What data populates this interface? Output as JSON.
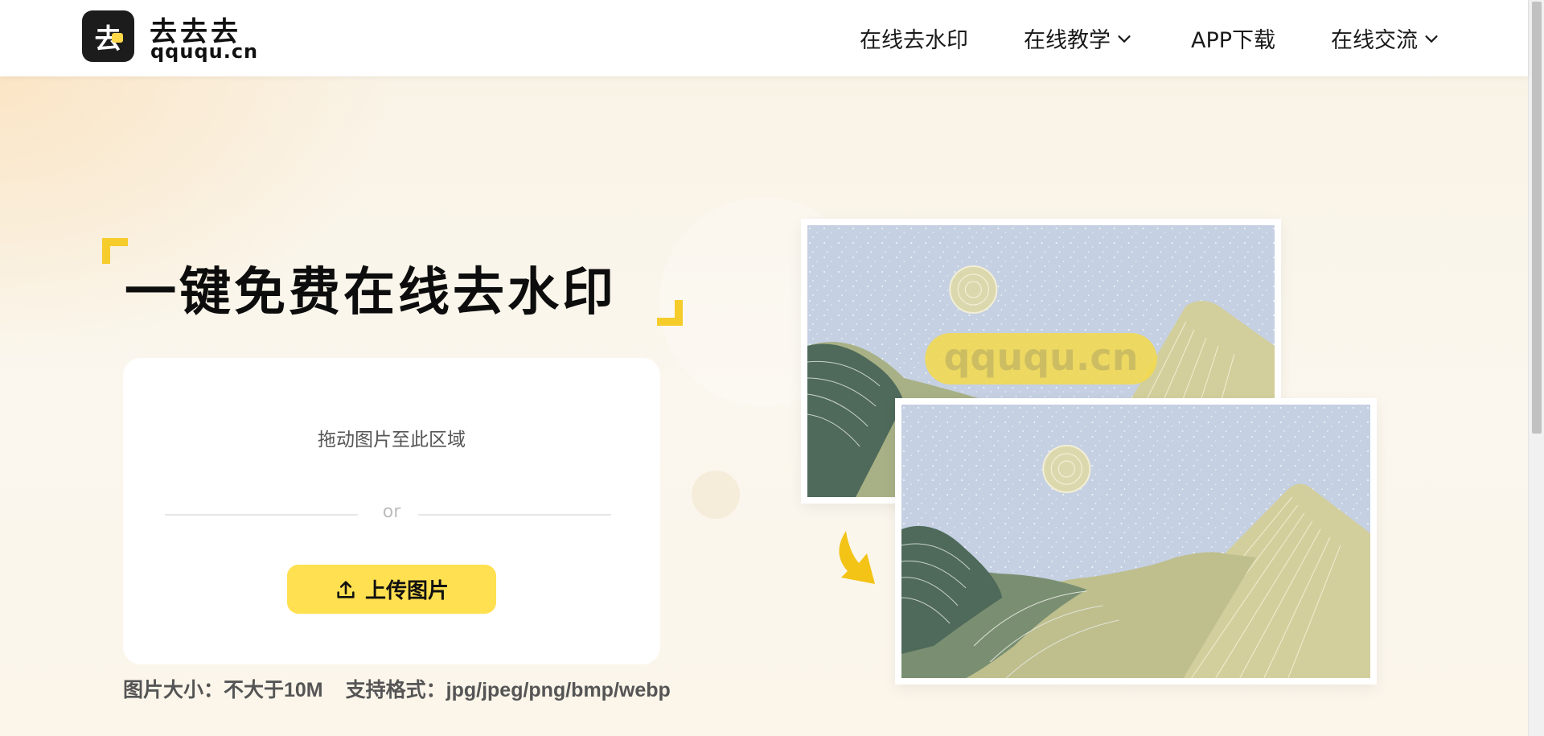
{
  "header": {
    "logo_glyph": "去",
    "logo_title": "去去去",
    "logo_domain": "qququ.cn",
    "nav": [
      {
        "label": "在线去水印",
        "icon": null
      },
      {
        "label": "在线教学",
        "icon": "chevron-down-icon"
      },
      {
        "label": "APP下载",
        "icon": null
      },
      {
        "label": "在线交流",
        "icon": "chevron-down-icon"
      }
    ]
  },
  "hero": {
    "headline": "一键免费在线去水印",
    "upload": {
      "drag_text": "拖动图片至此区域",
      "or_text": "or",
      "button_label": "上传图片",
      "button_icon": "upload-icon"
    },
    "specs": {
      "size": "图片大小：不大于10M",
      "formats": "支持格式：jpg/jpeg/png/bmp/webp"
    },
    "illustration": {
      "watermark_text": "qququ.cn",
      "arrow_icon": "curved-arrow-icon"
    }
  },
  "colors": {
    "accent": "#ffe050",
    "corner": "#f5cc2a",
    "sky": "#c5d0e2",
    "mountain_light": "#d3cf9c",
    "mountain_mid": "#a8b186",
    "mountain_dark": "#4f6a5a"
  }
}
